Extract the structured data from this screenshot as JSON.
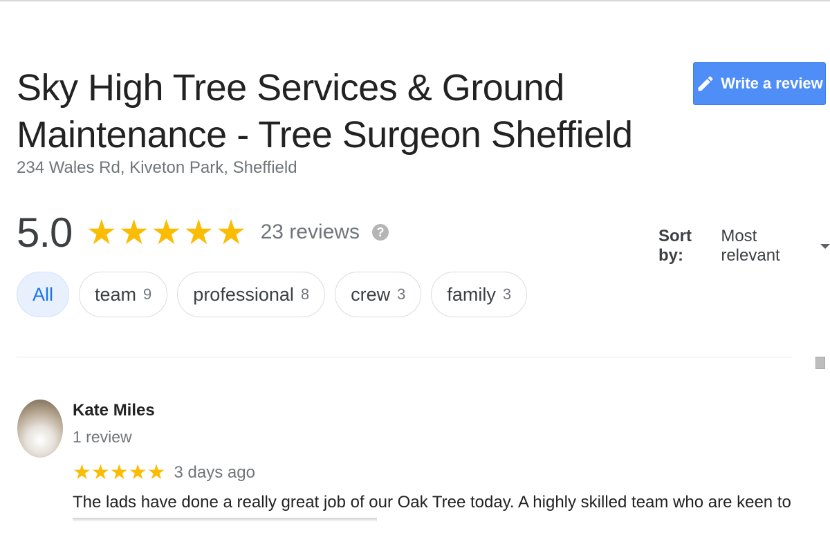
{
  "business": {
    "name": "Sky High Tree Services & Ground Maintenance - Tree Surgeon Sheffield",
    "address": "234 Wales Rd, Kiveton Park, Sheffield"
  },
  "actions": {
    "write_review_label": "Write a review",
    "write_review_icon": "pencil-icon"
  },
  "rating": {
    "value": "5.0",
    "stars": 5,
    "reviews_text": "23 reviews",
    "help_icon": "?",
    "star_color": "#fbbc04"
  },
  "sort": {
    "label": "Sort by:",
    "value": "Most relevant"
  },
  "filters": [
    {
      "label": "All",
      "count": "",
      "active": true
    },
    {
      "label": "team",
      "count": "9",
      "active": false
    },
    {
      "label": "professional",
      "count": "8",
      "active": false
    },
    {
      "label": "crew",
      "count": "3",
      "active": false
    },
    {
      "label": "family",
      "count": "3",
      "active": false
    }
  ],
  "reviews": [
    {
      "author": "Kate Miles",
      "meta": "1 review",
      "stars": 5,
      "date": "3 days ago",
      "text": "The lads have done a really great job of our Oak Tree today. A highly skilled team who are keen to"
    }
  ],
  "colors": {
    "accent": "#4f8ef7",
    "chip_active_bg": "#e8f0fe",
    "chip_active_text": "#1a73e8"
  }
}
